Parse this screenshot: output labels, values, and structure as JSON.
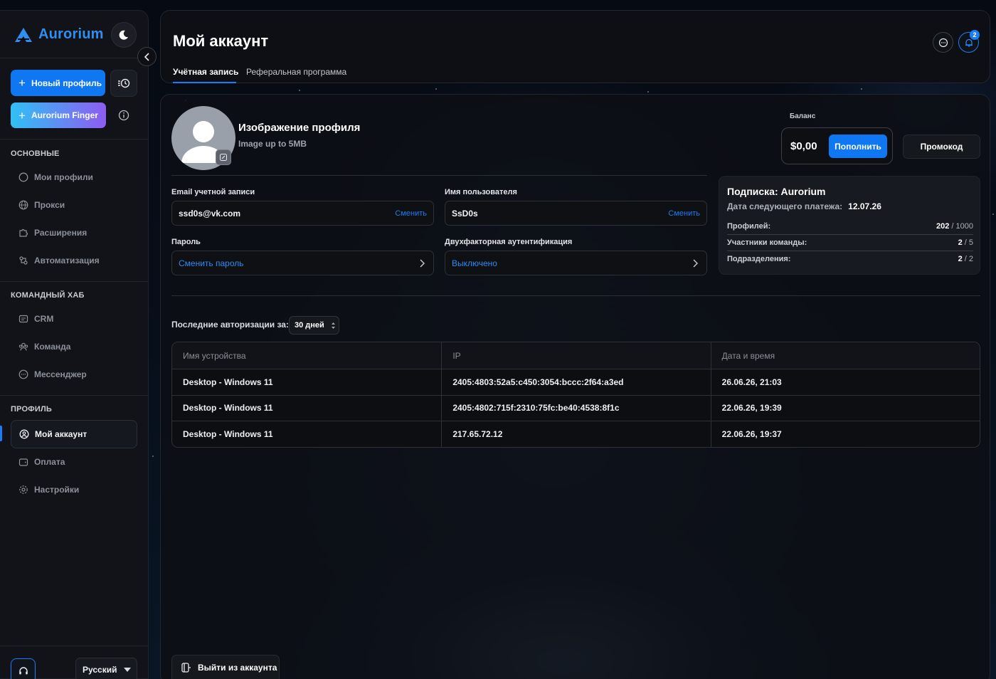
{
  "app": {
    "name": "Aurorium"
  },
  "sidebar": {
    "new_profile_label": "Новый профиль",
    "finger_label": "Aurorium Finger",
    "sections": {
      "main": "ОСНОВНЫЕ",
      "team": "КОМАНДНЫЙ ХАБ",
      "profile": "ПРОФИЛЬ"
    },
    "items": {
      "my_profiles": "Мои профили",
      "proxy": "Прокси",
      "extensions": "Расширения",
      "automation": "Автоматизация",
      "crm": "CRM",
      "team": "Команда",
      "messenger": "Мессенджер",
      "my_account": "Мой аккаунт",
      "payment": "Оплата",
      "settings": "Настройки"
    },
    "active_item": "my_account",
    "language": "Русский"
  },
  "header": {
    "title": "Мой аккаунт",
    "tabs": [
      {
        "label": "Учётная запись",
        "active": true
      },
      {
        "label": "Реферальная программа",
        "active": false
      }
    ],
    "notification_count": "2"
  },
  "profile": {
    "image_title": "Изображение профиля",
    "image_hint": "Image up to 5MB"
  },
  "account": {
    "email_label": "Email учетной записи",
    "email_value": "ssd0s@vk.com",
    "email_action": "Сменить",
    "username_label": "Имя пользователя",
    "username_value": "SsD0s",
    "username_action": "Сменить",
    "password_label": "Пароль",
    "password_action": "Сменить пароль",
    "twofa_label": "Двухфакторная аутентификация",
    "twofa_value": "Выключено"
  },
  "balance": {
    "label": "Баланс",
    "amount": "$0,00",
    "topup_label": "Пополнить",
    "promo_label": "Промокод"
  },
  "subscription": {
    "title": "Подписка: Aurorium",
    "next_payment_label": "Дата следующего платежа:",
    "next_payment_date": "12.07.26",
    "rows": [
      {
        "label": "Профилей:",
        "used": "202",
        "total": " / 1000"
      },
      {
        "label": "Участники команды:",
        "used": "2",
        "total": " / 5"
      },
      {
        "label": "Подразделения:",
        "used": "2",
        "total": " / 2"
      }
    ]
  },
  "auth_history": {
    "label": "Последние авторизации за:",
    "period": "30 дней",
    "columns": [
      "Имя устройства",
      "IP",
      "Дата и время"
    ],
    "rows": [
      [
        "Desktop - Windows 11",
        "2405:4803:52a5:c450:3054:bccc:2f64:a3ed",
        "26.06.26, 21:03"
      ],
      [
        "Desktop - Windows 11",
        "2405:4802:715f:2310:75fc:be40:4538:8f1c",
        "22.06.26, 19:39"
      ],
      [
        "Desktop - Windows 11",
        "217.65.72.12",
        "22.06.26, 19:37"
      ]
    ]
  },
  "logout_label": "Выйти из аккаунта",
  "colors": {
    "accent": "#1077f2",
    "brand": "#2f8ef0",
    "panel": "#111318"
  }
}
